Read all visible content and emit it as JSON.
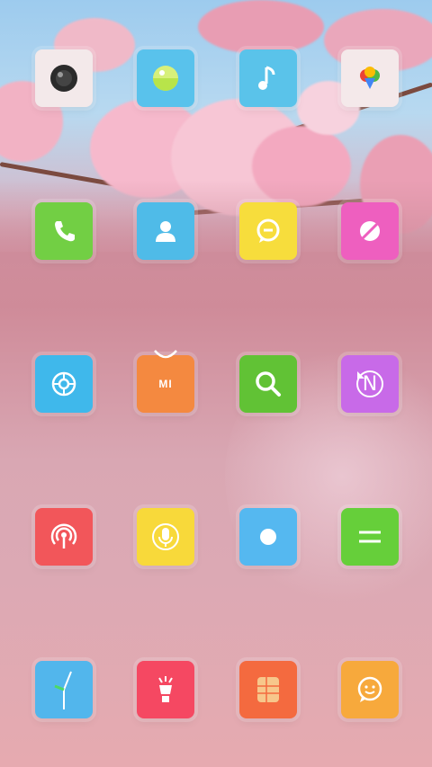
{
  "colors": {
    "camera": "#f3e9ea",
    "gallery": "#59c2ec",
    "music": "#5ac3ea",
    "photos": "#f4e9ea",
    "phone": "#72cf44",
    "contacts": "#4fbbe8",
    "messages": "#f7dd3c",
    "browser": "#ee5fbf",
    "settings": "#3fb8eb",
    "mi_store": "#f48940",
    "search": "#61c235",
    "notes": "#c86ae8",
    "hotspot": "#f2565a",
    "recorder": "#f8d93a",
    "screen_recorder": "#55b8f0",
    "calculator": "#66cf3a",
    "clock": "#52b6ec",
    "flashlight": "#f54862",
    "sim_toolkit": "#f46a3f",
    "feedback": "#f7a93c"
  },
  "apps": {
    "camera": {
      "icon": "camera-lens-icon"
    },
    "gallery": {
      "icon": "landscape-icon"
    },
    "music": {
      "icon": "music-note-icon"
    },
    "photos": {
      "icon": "google-photos-pin-icon"
    },
    "phone": {
      "icon": "phone-handset-icon"
    },
    "contacts": {
      "icon": "person-icon"
    },
    "messages": {
      "icon": "chat-bubble-icon"
    },
    "browser": {
      "icon": "browser-orbit-icon"
    },
    "settings": {
      "icon": "gear-icon"
    },
    "mi_store": {
      "icon": "mi-bag-icon",
      "label": "MI"
    },
    "search": {
      "icon": "magnifier-icon"
    },
    "notes": {
      "icon": "note-n-icon",
      "label": "N"
    },
    "hotspot": {
      "icon": "broadcast-icon"
    },
    "recorder": {
      "icon": "microphone-icon"
    },
    "screen_recorder": {
      "icon": "record-dot-icon"
    },
    "calculator": {
      "icon": "equals-icon"
    },
    "clock": {
      "icon": "clock-hands-icon"
    },
    "flashlight": {
      "icon": "flashlight-icon"
    },
    "sim_toolkit": {
      "icon": "sim-card-icon"
    },
    "feedback": {
      "icon": "smiley-chat-icon"
    }
  }
}
